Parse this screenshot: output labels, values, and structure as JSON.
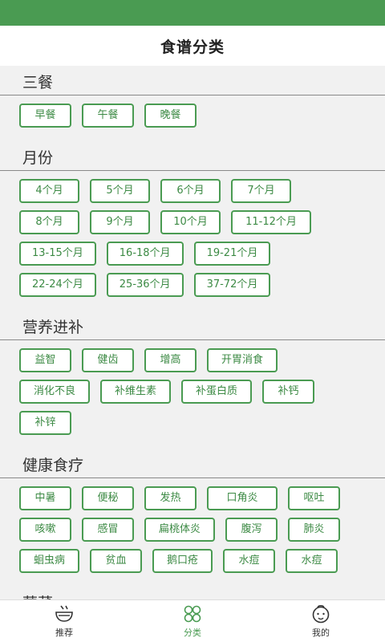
{
  "header": {
    "title": "食谱分类"
  },
  "sections": [
    {
      "title": "三餐",
      "tags": [
        "早餐",
        "午餐",
        "晚餐"
      ]
    },
    {
      "title": "月份",
      "tags": [
        "4个月",
        "5个月",
        "6个月",
        "7个月",
        "8个月",
        "9个月",
        "10个月",
        "11-12个月",
        "13-15个月",
        "16-18个月",
        "19-21个月",
        "22-24个月",
        "25-36个月",
        "37-72个月"
      ]
    },
    {
      "title": "营养进补",
      "tags": [
        "益智",
        "健齿",
        "增高",
        "开胃消食",
        "消化不良",
        "补维生素",
        "补蛋白质",
        "补钙",
        "补锌"
      ]
    },
    {
      "title": "健康食疗",
      "tags": [
        "中暑",
        "便秘",
        "发热",
        "口角炎",
        "呕吐",
        "咳嗽",
        "感冒",
        "扁桃体炎",
        "腹泻",
        "肺炎",
        "蛔虫病",
        "贫血",
        "鹅口疮",
        "水痘",
        "水痘"
      ]
    },
    {
      "title": "荤菜",
      "tags": []
    }
  ],
  "bottom_nav": [
    {
      "label": "推荐",
      "icon": "bowl-icon"
    },
    {
      "label": "分类",
      "icon": "grid-icon"
    },
    {
      "label": "我的",
      "icon": "baby-face-icon"
    }
  ],
  "colors": {
    "accent": "#4a9b52"
  }
}
